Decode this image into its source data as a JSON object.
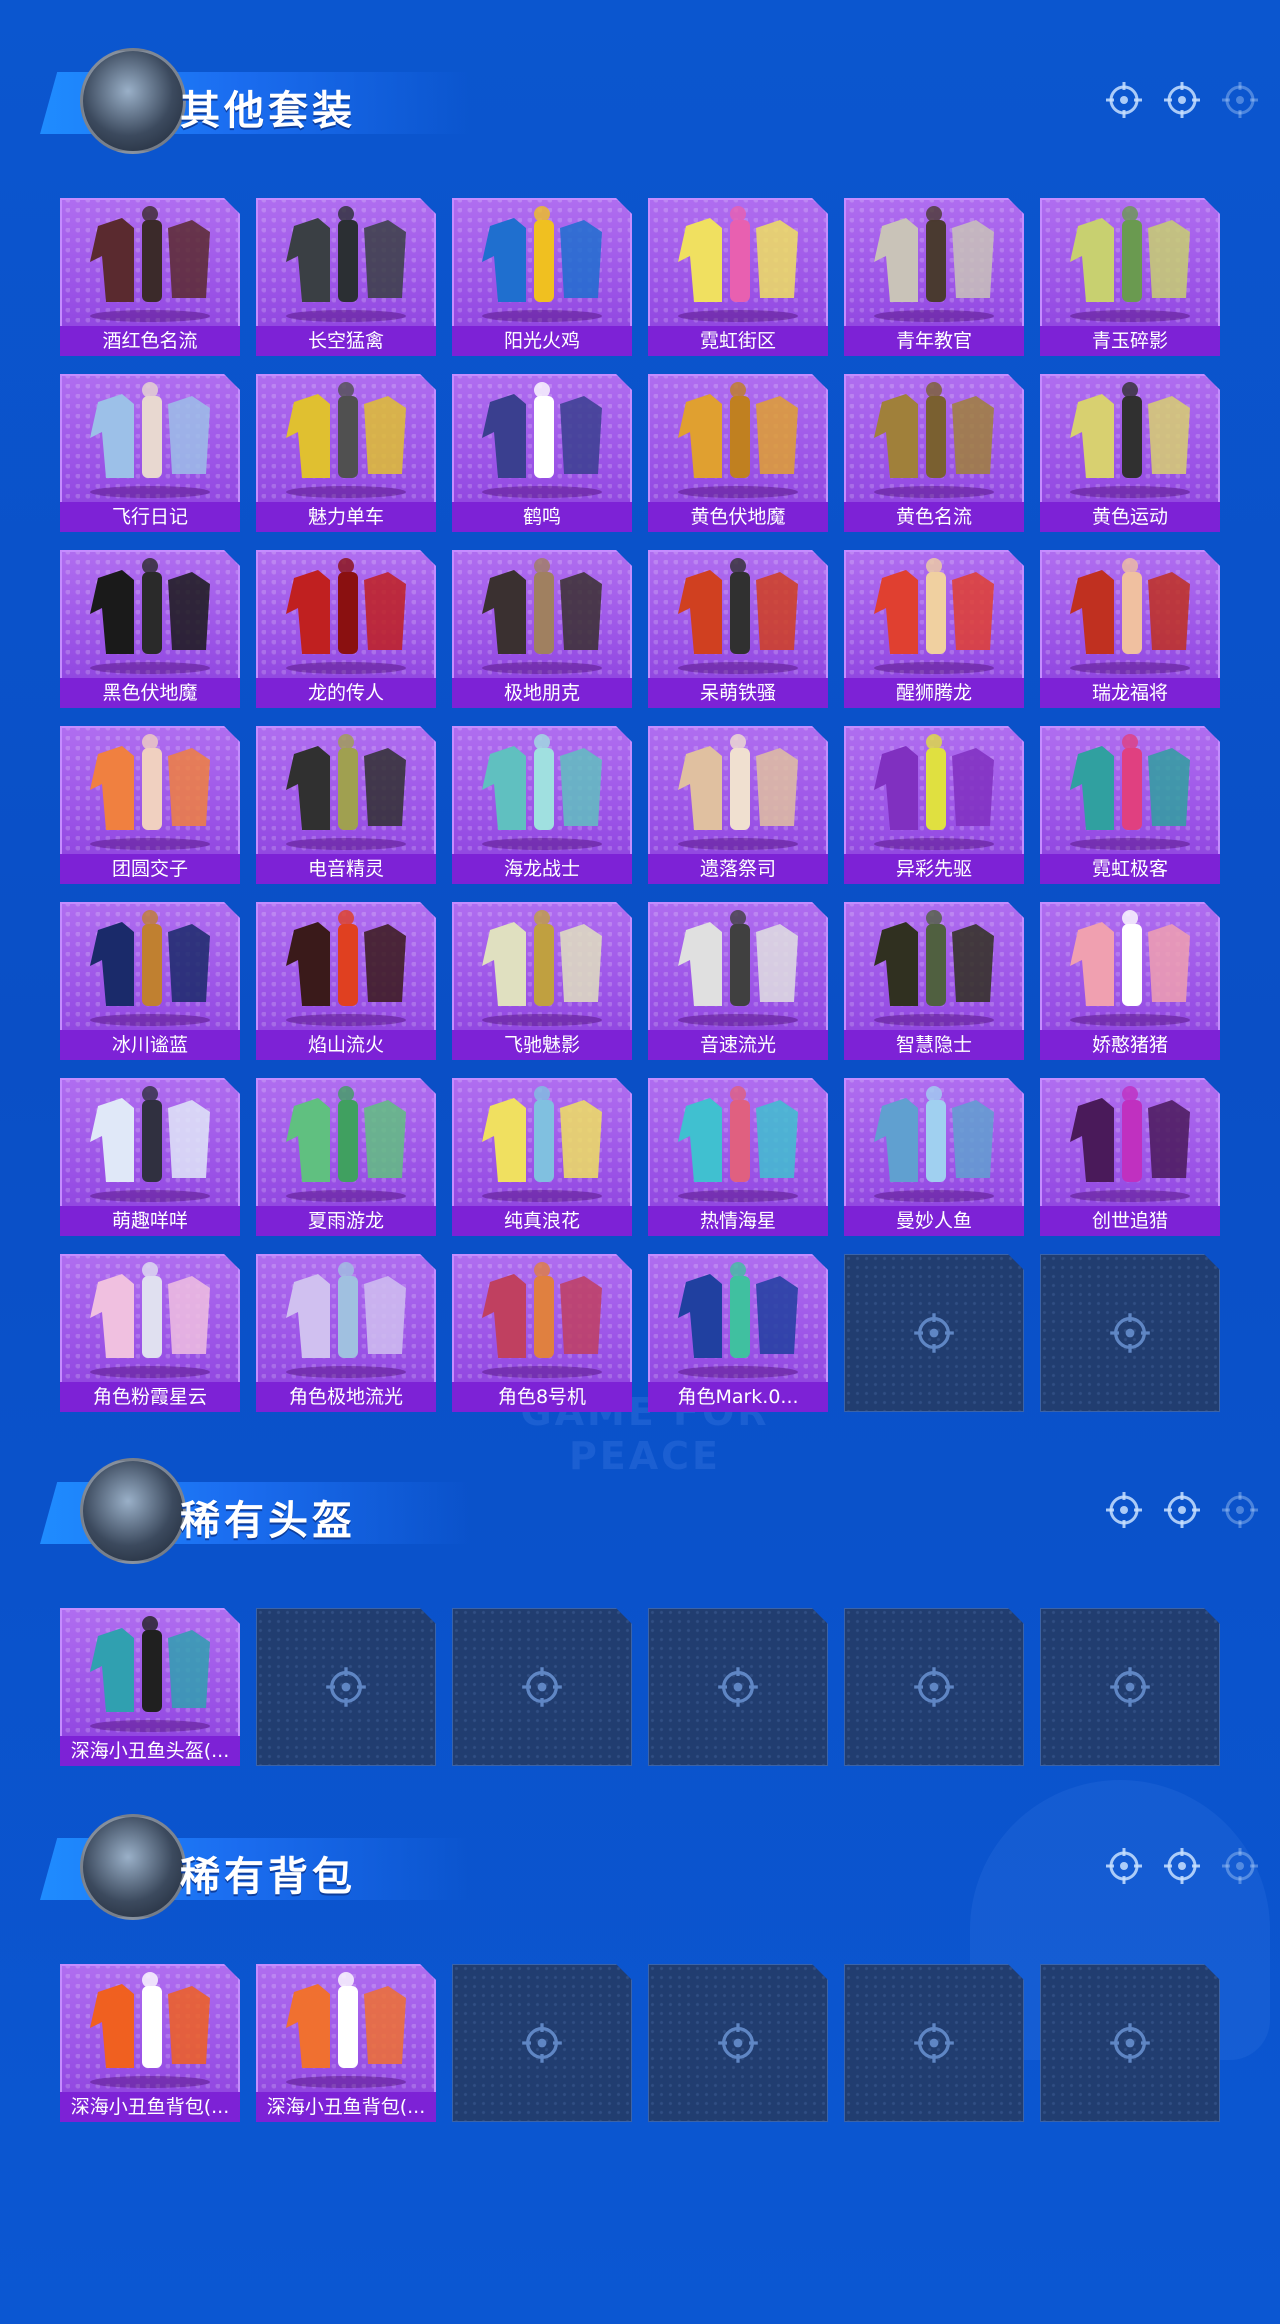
{
  "watermark": "GAME FOR PEACE",
  "sections": [
    {
      "title": "其他套装",
      "items": [
        {
          "label": "酒红色名流",
          "c1": "#5a2a2f",
          "c2": "#3b2a2a"
        },
        {
          "label": "长空猛禽",
          "c1": "#3a3f44",
          "c2": "#2b2f33"
        },
        {
          "label": "阳光火鸡",
          "c1": "#1f6fcf",
          "c2": "#f0c020"
        },
        {
          "label": "霓虹街区",
          "c1": "#f0e060",
          "c2": "#e860b0"
        },
        {
          "label": "青年教官",
          "c1": "#c9c3b8",
          "c2": "#4a3a30"
        },
        {
          "label": "青玉碎影",
          "c1": "#c8d070",
          "c2": "#6a9a50"
        },
        {
          "label": "飞行日记",
          "c1": "#9cc0e8",
          "c2": "#e8d8d0"
        },
        {
          "label": "魅力单车",
          "c1": "#e0c030",
          "c2": "#505050"
        },
        {
          "label": "鹤鸣",
          "c1": "#3a3f8f",
          "c2": "#ffffff"
        },
        {
          "label": "黄色伏地魔",
          "c1": "#e0a030",
          "c2": "#c08020"
        },
        {
          "label": "黄色名流",
          "c1": "#a0803a",
          "c2": "#7a6030"
        },
        {
          "label": "黄色运动",
          "c1": "#d8d070",
          "c2": "#303030"
        },
        {
          "label": "黑色伏地魔",
          "c1": "#1a1a1a",
          "c2": "#2a2a2a"
        },
        {
          "label": "龙的传人",
          "c1": "#c02020",
          "c2": "#8a1010"
        },
        {
          "label": "极地朋克",
          "c1": "#3a3030",
          "c2": "#a08060"
        },
        {
          "label": "呆萌铁骚",
          "c1": "#d04020",
          "c2": "#303030"
        },
        {
          "label": "醒狮腾龙",
          "c1": "#e04030",
          "c2": "#f0d0a0"
        },
        {
          "label": "瑞龙福将",
          "c1": "#c03020",
          "c2": "#f0c0a0"
        },
        {
          "label": "团圆交子",
          "c1": "#f08040",
          "c2": "#f0d0c0"
        },
        {
          "label": "电音精灵",
          "c1": "#303030",
          "c2": "#a0a050"
        },
        {
          "label": "海龙战士",
          "c1": "#60c0c0",
          "c2": "#a0e0e0"
        },
        {
          "label": "遗落祭司",
          "c1": "#e0c0a0",
          "c2": "#f0e0d0"
        },
        {
          "label": "异彩先驱",
          "c1": "#8030c0",
          "c2": "#e0e040"
        },
        {
          "label": "霓虹极客",
          "c1": "#30a0a0",
          "c2": "#e04080"
        },
        {
          "label": "冰川谧蓝",
          "c1": "#1a2a6a",
          "c2": "#c08030"
        },
        {
          "label": "焰山流火",
          "c1": "#3a1a1a",
          "c2": "#e04020"
        },
        {
          "label": "飞驰魅影",
          "c1": "#e0e0c0",
          "c2": "#c0a040"
        },
        {
          "label": "音速流光",
          "c1": "#e0e0e0",
          "c2": "#404040"
        },
        {
          "label": "智慧隐士",
          "c1": "#303020",
          "c2": "#506040"
        },
        {
          "label": "娇憨猪猪",
          "c1": "#f0a0b0",
          "c2": "#ffffff"
        },
        {
          "label": "萌趣咩咩",
          "c1": "#e0e8f8",
          "c2": "#303040"
        },
        {
          "label": "夏雨游龙",
          "c1": "#60c080",
          "c2": "#40a060"
        },
        {
          "label": "纯真浪花",
          "c1": "#f0e060",
          "c2": "#80c0e0"
        },
        {
          "label": "热情海星",
          "c1": "#40c0d0",
          "c2": "#e06080"
        },
        {
          "label": "曼妙人鱼",
          "c1": "#60a0d0",
          "c2": "#a0d0f0"
        },
        {
          "label": "创世追猎",
          "c1": "#4a1a5a",
          "c2": "#c030c0"
        },
        {
          "label": "角色粉霞星云",
          "c1": "#f0c0e0",
          "c2": "#e0e0f0"
        },
        {
          "label": "角色极地流光",
          "c1": "#d0c0f0",
          "c2": "#a0c0e0"
        },
        {
          "label": "角色8号机",
          "c1": "#c04060",
          "c2": "#e08040"
        },
        {
          "label": "角色Mark.0...",
          "c1": "#2040a0",
          "c2": "#40c0a0"
        },
        {
          "label": "",
          "c1": "",
          "c2": ""
        },
        {
          "label": "",
          "c1": "",
          "c2": ""
        }
      ]
    },
    {
      "title": "稀有头盔",
      "items": [
        {
          "label": "深海小丑鱼头盔(...",
          "c1": "#30a0b0",
          "c2": "#202020"
        },
        {
          "label": "",
          "c1": "",
          "c2": ""
        },
        {
          "label": "",
          "c1": "",
          "c2": ""
        },
        {
          "label": "",
          "c1": "",
          "c2": ""
        },
        {
          "label": "",
          "c1": "",
          "c2": ""
        },
        {
          "label": "",
          "c1": "",
          "c2": ""
        }
      ]
    },
    {
      "title": "稀有背包",
      "items": [
        {
          "label": "深海小丑鱼背包(...",
          "c1": "#f06020",
          "c2": "#ffffff"
        },
        {
          "label": "深海小丑鱼背包(...",
          "c1": "#f07030",
          "c2": "#ffffff"
        },
        {
          "label": "",
          "c1": "",
          "c2": ""
        },
        {
          "label": "",
          "c1": "",
          "c2": ""
        },
        {
          "label": "",
          "c1": "",
          "c2": ""
        },
        {
          "label": "",
          "c1": "",
          "c2": ""
        }
      ]
    }
  ]
}
